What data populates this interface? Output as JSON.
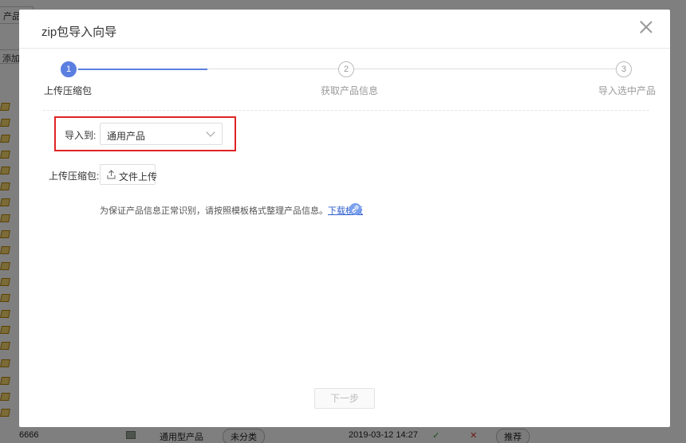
{
  "background": {
    "tab_label": "产品库",
    "add_label": "添加 ▾",
    "bottom_row": {
      "id": "6666",
      "type": "通用型产品",
      "category": "未分类",
      "datetime": "2019-03-12 14:27",
      "check": "✓",
      "cross": "✕",
      "recommend": "推荐"
    }
  },
  "modal": {
    "title": "zip包导入向导",
    "steps": [
      {
        "number": "1",
        "label": "上传压缩包"
      },
      {
        "number": "2",
        "label": "获取产品信息"
      },
      {
        "number": "3",
        "label": "导入选中产品"
      }
    ],
    "current_step": 1,
    "import_to_label": "导入到:",
    "import_to_value": "通用产品",
    "upload_label": "上传压缩包:",
    "upload_button": "文件上传",
    "hint_text": "为保证产品信息正常识别，请按照模板格式整理产品信息。",
    "hint_link": "下载模板",
    "next_button": "下一步"
  },
  "colors": {
    "accent": "#5b7fe0",
    "highlight": "#e02424"
  }
}
